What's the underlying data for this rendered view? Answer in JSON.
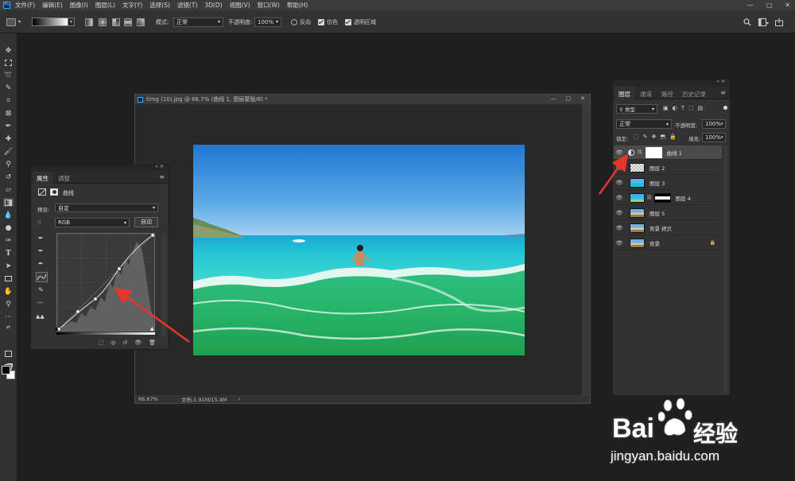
{
  "menubar": {
    "logo": "Ps",
    "items": [
      "文件(F)",
      "编辑(E)",
      "图像(I)",
      "图层(L)",
      "文字(Y)",
      "选择(S)",
      "滤镜(T)",
      "3D(D)",
      "视图(V)",
      "窗口(W)",
      "帮助(H)"
    ],
    "window_controls": [
      "—",
      "▢",
      "✕"
    ]
  },
  "options_bar": {
    "mode_label": "模式:",
    "mode_value": "正常",
    "opacity_label": "不透明度:",
    "opacity_value": "100%",
    "reverse_label": "反向",
    "dither_label": "仿色",
    "transparency_label": "透明区域"
  },
  "document": {
    "title": "timg (10).jpg @ 66.7% (曲线 1, 图层蒙版/8) *",
    "zoom": "66.67%",
    "doc_info": "文档:1.91M/15.4M"
  },
  "properties_panel": {
    "tabs": [
      "属性",
      "调整"
    ],
    "header_label": "曲线",
    "preset_label": "预设:",
    "preset_value": "自定",
    "channel_value": "RGB",
    "auto_button": "自动"
  },
  "layers_panel": {
    "tabs": [
      "图层",
      "通道",
      "路径",
      "历史记录"
    ],
    "filter_label": "类型",
    "blend_mode": "正常",
    "opacity_label": "不透明度:",
    "opacity_value": "100%",
    "lock_label": "锁定:",
    "fill_label": "填充:",
    "fill_value": "100%",
    "layers": [
      {
        "name": "曲线 1"
      },
      {
        "name": "图层 2"
      },
      {
        "name": "图层 3"
      },
      {
        "name": "图层 4"
      },
      {
        "name": "图层 5"
      },
      {
        "name": "背景 拷贝"
      },
      {
        "name": "背景"
      }
    ]
  },
  "watermark": {
    "brand": "Bai",
    "brand_suffix": "经验",
    "url": "jingyan.baidu.com"
  },
  "colors": {
    "annotation_arrow": "#e8352a",
    "app_bg": "#1f1f1f",
    "panel_bg": "#323232"
  }
}
